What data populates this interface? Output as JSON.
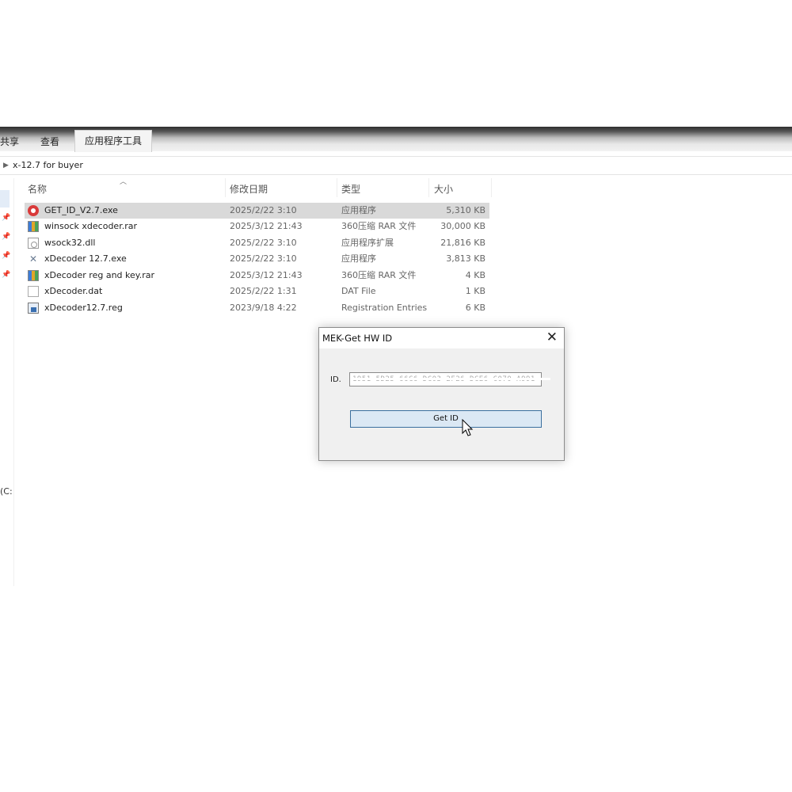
{
  "ribbon": {
    "tabs": [
      "共享",
      "查看",
      "应用程序工具"
    ]
  },
  "address_bar": {
    "path": "x-12.7 for buyer"
  },
  "nav_pane": {
    "drive_label": "(C:"
  },
  "file_list": {
    "columns": [
      "名称",
      "修改日期",
      "类型",
      "大小"
    ],
    "rows": [
      {
        "name": "GET_ID_V2.7.exe",
        "date": "2025/2/22 3:10",
        "type": "应用程序",
        "size": "5,310 KB",
        "icon": "exe-app-icon",
        "selected": true
      },
      {
        "name": "winsock xdecoder.rar",
        "date": "2025/3/12 21:43",
        "type": "360压缩 RAR 文件",
        "size": "30,000 KB",
        "icon": "rar-archive-icon"
      },
      {
        "name": "wsock32.dll",
        "date": "2025/2/22 3:10",
        "type": "应用程序扩展",
        "size": "21,816 KB",
        "icon": "dll-file-icon"
      },
      {
        "name": "xDecoder 12.7.exe",
        "date": "2025/2/22 3:10",
        "type": "应用程序",
        "size": "3,813 KB",
        "icon": "xdecoder-app-icon"
      },
      {
        "name": "xDecoder reg and key.rar",
        "date": "2025/3/12 21:43",
        "type": "360压缩 RAR 文件",
        "size": "4 KB",
        "icon": "rar-archive-icon"
      },
      {
        "name": "xDecoder.dat",
        "date": "2025/2/22 1:31",
        "type": "DAT File",
        "size": "1 KB",
        "icon": "dat-file-icon"
      },
      {
        "name": "xDecoder12.7.reg",
        "date": "2023/9/18 4:22",
        "type": "Registration Entries",
        "size": "6 KB",
        "icon": "reg-file-icon"
      }
    ]
  },
  "dialog": {
    "title": "MEK-Get HW ID",
    "close_glyph": "✕",
    "id_label": "ID.",
    "id_value": "1951 5D25 66C6 DC03 2F26 DCE6 C070 A991",
    "button_label": "Get ID"
  },
  "colors": {
    "selected_row": "#d9d9d9",
    "button_fill": "#dbe8f4",
    "button_border": "#3b6f9e"
  }
}
